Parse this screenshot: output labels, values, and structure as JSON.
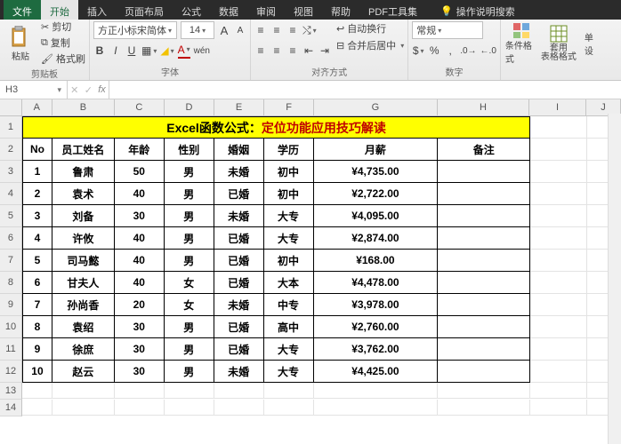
{
  "tabs": {
    "file": "文件",
    "home": "开始",
    "insert": "插入",
    "layout": "页面布局",
    "formula": "公式",
    "data": "数据",
    "review": "审阅",
    "view": "视图",
    "help": "帮助",
    "pdf": "PDF工具集",
    "search_hint": "操作说明搜索"
  },
  "ribbon": {
    "paste": "粘贴",
    "cut": "剪切",
    "copy": "复制",
    "format_painter": "格式刷",
    "group_clipboard": "剪贴板",
    "font_name": "方正小标宋简体",
    "font_size": "14",
    "group_font": "字体",
    "wrap_text": "自动换行",
    "merge_center": "合并后居中",
    "group_align": "对齐方式",
    "number_format": "常规",
    "group_number": "数字",
    "cond_fmt": "条件格式",
    "format_table": "套用\n表格格式",
    "cell_style_pre": "单",
    "cell_style_suf": "设"
  },
  "namebox": "H3",
  "cols": [
    "A",
    "B",
    "C",
    "D",
    "E",
    "F",
    "G",
    "H",
    "I",
    "J"
  ],
  "title_pre": "Excel函数公式：",
  "title_red": "定位功能应用技巧解读",
  "headers": {
    "no": "No",
    "name": "员工姓名",
    "age": "年龄",
    "gender": "性别",
    "marital": "婚姻",
    "edu": "学历",
    "salary": "月薪",
    "remark": "备注"
  },
  "rows": [
    {
      "no": "1",
      "name": "鲁肃",
      "age": "50",
      "gender": "男",
      "marital": "未婚",
      "edu": "初中",
      "salary": "¥4,735.00"
    },
    {
      "no": "2",
      "name": "袁术",
      "age": "40",
      "gender": "男",
      "marital": "已婚",
      "edu": "初中",
      "salary": "¥2,722.00"
    },
    {
      "no": "3",
      "name": "刘备",
      "age": "30",
      "gender": "男",
      "marital": "未婚",
      "edu": "大专",
      "salary": "¥4,095.00"
    },
    {
      "no": "4",
      "name": "许攸",
      "age": "40",
      "gender": "男",
      "marital": "已婚",
      "edu": "大专",
      "salary": "¥2,874.00"
    },
    {
      "no": "5",
      "name": "司马懿",
      "age": "40",
      "gender": "男",
      "marital": "已婚",
      "edu": "初中",
      "salary": "¥168.00"
    },
    {
      "no": "6",
      "name": "甘夫人",
      "age": "40",
      "gender": "女",
      "marital": "已婚",
      "edu": "大本",
      "salary": "¥4,478.00"
    },
    {
      "no": "7",
      "name": "孙尚香",
      "age": "20",
      "gender": "女",
      "marital": "未婚",
      "edu": "中专",
      "salary": "¥3,978.00"
    },
    {
      "no": "8",
      "name": "袁绍",
      "age": "30",
      "gender": "男",
      "marital": "已婚",
      "edu": "高中",
      "salary": "¥2,760.00"
    },
    {
      "no": "9",
      "name": "徐庶",
      "age": "30",
      "gender": "男",
      "marital": "已婚",
      "edu": "大专",
      "salary": "¥3,762.00"
    },
    {
      "no": "10",
      "name": "赵云",
      "age": "30",
      "gender": "男",
      "marital": "未婚",
      "edu": "大专",
      "salary": "¥4,425.00"
    }
  ]
}
